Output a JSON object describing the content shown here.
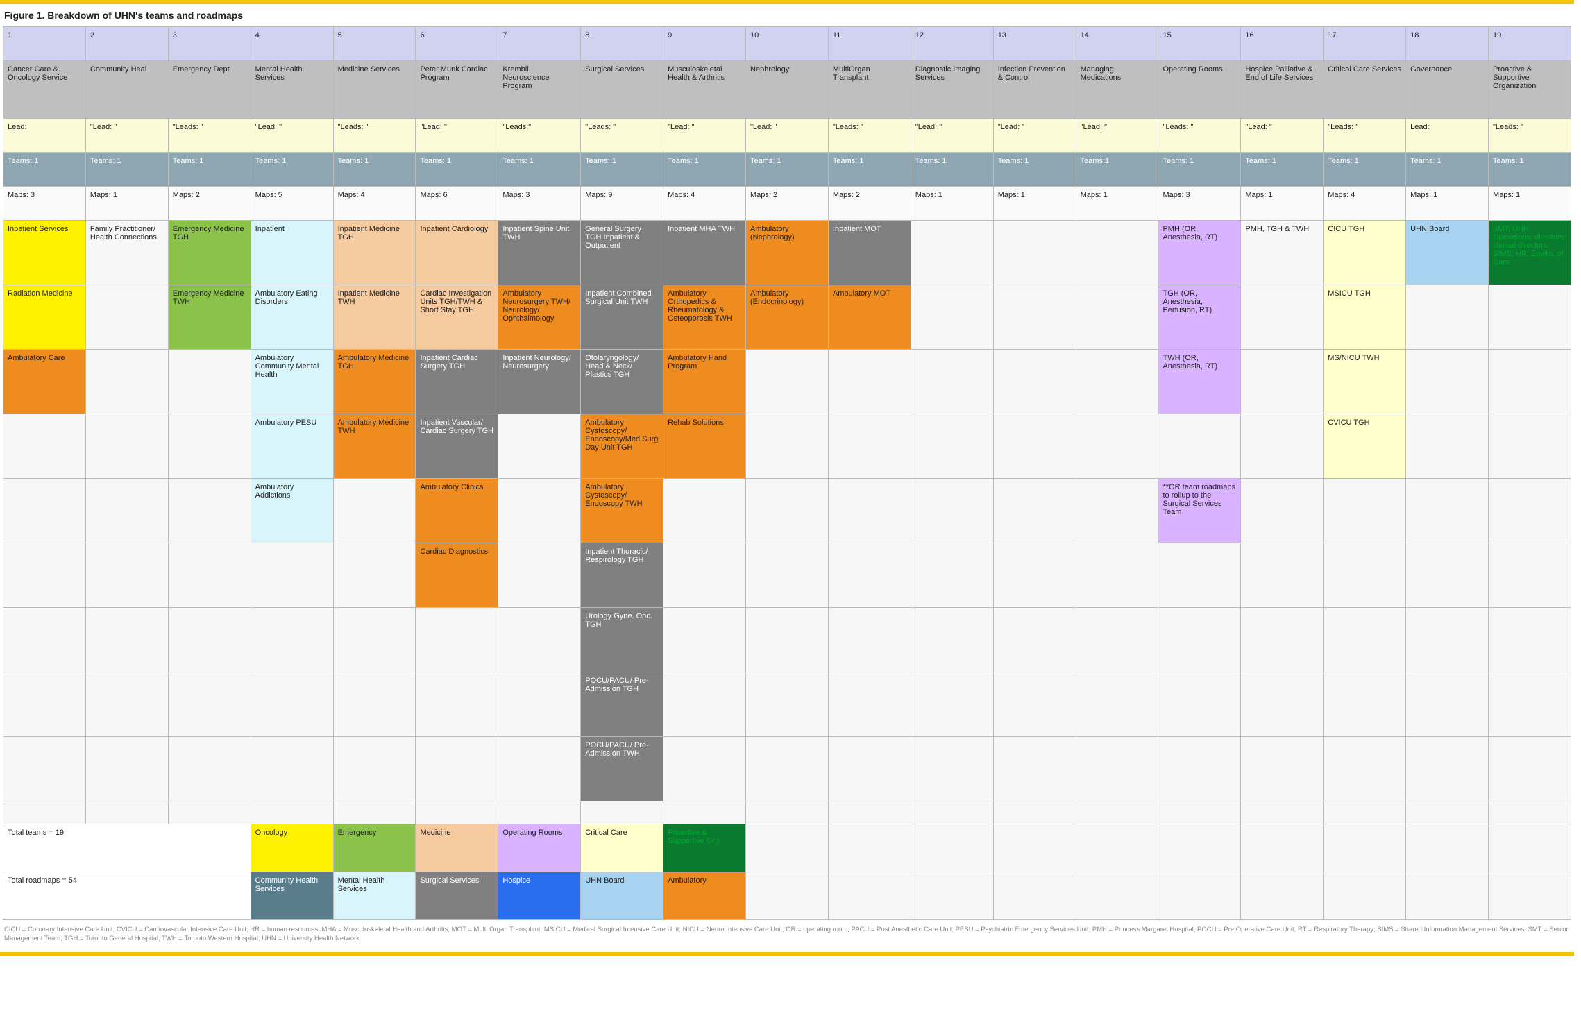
{
  "title": "Figure 1. Breakdown of UHN's teams and roadmaps",
  "columns": [
    {
      "num": "1",
      "name": "Cancer Care & Oncology Service",
      "lead": "Lead:",
      "teams": "Teams: 1",
      "maps": "Maps: 3"
    },
    {
      "num": "2",
      "name": "Community Heal",
      "lead": "\"Lead:\n\"",
      "teams": "Teams: 1",
      "maps": "Maps: 1"
    },
    {
      "num": "3",
      "name": "Emergency Dept",
      "lead": "\"Leads:\n\"",
      "teams": "Teams: 1",
      "maps": "Maps: 2"
    },
    {
      "num": "4",
      "name": "Mental Health Services",
      "lead": "\"Lead:\n\"",
      "teams": "Teams: 1",
      "maps": "Maps: 5"
    },
    {
      "num": "5",
      "name": "Medicine Services",
      "lead": "\"Leads:\n\"",
      "teams": "Teams: 1",
      "maps": "Maps: 4"
    },
    {
      "num": "6",
      "name": "Peter Munk Cardiac Program",
      "lead": "\"Lead:\n\"",
      "teams": "Teams: 1",
      "maps": "Maps: 6"
    },
    {
      "num": "7",
      "name": "Krembil Neuroscience Program",
      "lead": "\"Leads:\"",
      "teams": "Teams: 1",
      "maps": "Maps: 3"
    },
    {
      "num": "8",
      "name": "Surgical Services",
      "lead": "\"Leads:\n\"",
      "teams": "Teams: 1",
      "maps": "Maps: 9"
    },
    {
      "num": "9",
      "name": "Musculoskeletal Health & Arthritis",
      "lead": "\"Lead:\n\"",
      "teams": "Teams: 1",
      "maps": "Maps: 4"
    },
    {
      "num": "10",
      "name": "Nephrology",
      "lead": "\"Lead:\n\"",
      "teams": "Teams: 1",
      "maps": "Maps: 2"
    },
    {
      "num": "11",
      "name": "MultiOrgan Transplant",
      "lead": "\"Leads:\n\"",
      "teams": "Teams: 1",
      "maps": "Maps: 2"
    },
    {
      "num": "12",
      "name": "Diagnostic Imaging Services",
      "lead": "\"Lead:\n\"",
      "teams": "Teams: 1",
      "maps": "Maps: 1"
    },
    {
      "num": "13",
      "name": "Infection Prevention & Control",
      "lead": "\"Lead:\n\"",
      "teams": "Teams: 1",
      "maps": "Maps: 1"
    },
    {
      "num": "14",
      "name": "Managing Medications",
      "lead": "\"Lead:\n\"",
      "teams": "Teams:1",
      "maps": "Maps: 1"
    },
    {
      "num": "15",
      "name": "Operating Rooms",
      "lead": "\"Leads:\n\"",
      "teams": "Teams: 1",
      "maps": "Maps: 3"
    },
    {
      "num": "16",
      "name": "Hospice Palliative & End of Life Services",
      "lead": "\"Lead:\n\"",
      "teams": "Teams: 1",
      "maps": "Maps: 1"
    },
    {
      "num": "17",
      "name": "Critical Care Services",
      "lead": "\"Leads:\n\"",
      "teams": "Teams: 1",
      "maps": "Maps: 4"
    },
    {
      "num": "18",
      "name": "Governance",
      "lead": "Lead:",
      "teams": "Teams: 1",
      "maps": "Maps: 1"
    },
    {
      "num": "19",
      "name": "Proactive & Supportive Organization",
      "lead": "\"Leads:\n\"",
      "teams": "Teams: 1",
      "maps": "Maps: 1"
    }
  ],
  "mapRows": [
    [
      {
        "t": "Inpatient Services",
        "c": "c-yellow"
      },
      {
        "t": "Family Practitioner/ Health Connections",
        "c": "c-blank"
      },
      {
        "t": "Emergency Medicine TGH",
        "c": "c-green"
      },
      {
        "t": "Inpatient",
        "c": "c-palecyan"
      },
      {
        "t": "Inpatient Medicine TGH",
        "c": "c-peach"
      },
      {
        "t": "Inpatient Cardiology",
        "c": "c-peach"
      },
      {
        "t": "Inpatient Spine Unit TWH",
        "c": "c-gray"
      },
      {
        "t": "General Surgery TGH Inpatient & Outpatient",
        "c": "c-gray"
      },
      {
        "t": "Inpatient MHA TWH",
        "c": "c-gray"
      },
      {
        "t": "Ambulatory (Nephrology)",
        "c": "c-orange"
      },
      {
        "t": "Inpatient MOT",
        "c": "c-gray"
      },
      {
        "t": "",
        "c": "c-blank"
      },
      {
        "t": "",
        "c": "c-blank"
      },
      {
        "t": "",
        "c": "c-blank"
      },
      {
        "t": "PMH (OR, Anesthesia, RT)",
        "c": "c-lilac"
      },
      {
        "t": "PMH, TGH & TWH",
        "c": "c-blank"
      },
      {
        "t": "CICU TGH",
        "c": "c-paleyellow"
      },
      {
        "t": "UHN Board",
        "c": "c-skyblue"
      },
      {
        "t": "SMT; UHN Operations; directors; clinical directors; SIMS; HR; Enviro. of Care",
        "c": "c-darkgreen"
      }
    ],
    [
      {
        "t": "Radiation Medicine",
        "c": "c-yellow"
      },
      {
        "t": "",
        "c": "c-blank"
      },
      {
        "t": "Emergency Medicine TWH",
        "c": "c-green"
      },
      {
        "t": "Ambulatory Eating Disorders",
        "c": "c-palecyan"
      },
      {
        "t": "Inpatient Medicine TWH",
        "c": "c-peach"
      },
      {
        "t": "Cardiac Investigation Units TGH/TWH & Short Stay TGH",
        "c": "c-peach"
      },
      {
        "t": "Ambulatory Neurosurgery TWH/ Neurology/ Ophthalmology",
        "c": "c-orange"
      },
      {
        "t": "Inpatient Combined Surgical Unit TWH",
        "c": "c-gray"
      },
      {
        "t": "Ambulatory Orthopedics & Rheumatology & Osteoporosis TWH",
        "c": "c-orange"
      },
      {
        "t": "Ambulatory (Endocrinology)",
        "c": "c-orange"
      },
      {
        "t": "Ambulatory MOT",
        "c": "c-orange"
      },
      {
        "t": "",
        "c": "c-blank"
      },
      {
        "t": "",
        "c": "c-blank"
      },
      {
        "t": "",
        "c": "c-blank"
      },
      {
        "t": "TGH (OR, Anesthesia, Perfusion, RT)",
        "c": "c-lilac"
      },
      {
        "t": "",
        "c": "c-blank"
      },
      {
        "t": "MSICU TGH",
        "c": "c-paleyellow"
      },
      {
        "t": "",
        "c": "c-blank"
      },
      {
        "t": "",
        "c": "c-blank"
      }
    ],
    [
      {
        "t": "Ambulatory Care",
        "c": "c-orange"
      },
      {
        "t": "",
        "c": "c-blank"
      },
      {
        "t": "",
        "c": "c-blank"
      },
      {
        "t": "Ambulatory Community Mental Health",
        "c": "c-palecyan"
      },
      {
        "t": "Ambulatory Medicine TGH",
        "c": "c-orange"
      },
      {
        "t": "Inpatient Cardiac Surgery TGH",
        "c": "c-gray"
      },
      {
        "t": "Inpatient Neurology/ Neurosurgery",
        "c": "c-gray"
      },
      {
        "t": "Otolaryngology/ Head & Neck/ Plastics TGH",
        "c": "c-gray"
      },
      {
        "t": "Ambulatory Hand Program",
        "c": "c-orange"
      },
      {
        "t": "",
        "c": "c-blank"
      },
      {
        "t": "",
        "c": "c-blank"
      },
      {
        "t": "",
        "c": "c-blank"
      },
      {
        "t": "",
        "c": "c-blank"
      },
      {
        "t": "",
        "c": "c-blank"
      },
      {
        "t": "TWH (OR, Anesthesia, RT)",
        "c": "c-lilac"
      },
      {
        "t": "",
        "c": "c-blank"
      },
      {
        "t": "MS/NICU TWH",
        "c": "c-paleyellow"
      },
      {
        "t": "",
        "c": "c-blank"
      },
      {
        "t": "",
        "c": "c-blank"
      }
    ],
    [
      {
        "t": "",
        "c": "c-blank"
      },
      {
        "t": "",
        "c": "c-blank"
      },
      {
        "t": "",
        "c": "c-blank"
      },
      {
        "t": "Ambulatory PESU",
        "c": "c-palecyan"
      },
      {
        "t": "Ambulatory Medicine TWH",
        "c": "c-orange"
      },
      {
        "t": "Inpatient Vascular/ Cardiac Surgery TGH",
        "c": "c-gray"
      },
      {
        "t": "",
        "c": "c-blank"
      },
      {
        "t": "Ambulatory Cystoscopy/ Endoscopy/Med Surg Day Unit TGH",
        "c": "c-orange"
      },
      {
        "t": "Rehab Solutions",
        "c": "c-orange"
      },
      {
        "t": "",
        "c": "c-blank"
      },
      {
        "t": "",
        "c": "c-blank"
      },
      {
        "t": "",
        "c": "c-blank"
      },
      {
        "t": "",
        "c": "c-blank"
      },
      {
        "t": "",
        "c": "c-blank"
      },
      {
        "t": "",
        "c": "c-blank"
      },
      {
        "t": "",
        "c": "c-blank"
      },
      {
        "t": "CVICU TGH",
        "c": "c-paleyellow"
      },
      {
        "t": "",
        "c": "c-blank"
      },
      {
        "t": "",
        "c": "c-blank"
      }
    ],
    [
      {
        "t": "",
        "c": "c-blank"
      },
      {
        "t": "",
        "c": "c-blank"
      },
      {
        "t": "",
        "c": "c-blank"
      },
      {
        "t": "Ambulatory Addictions",
        "c": "c-palecyan"
      },
      {
        "t": "",
        "c": "c-blank"
      },
      {
        "t": "Ambulatory Clinics",
        "c": "c-orange"
      },
      {
        "t": "",
        "c": "c-blank"
      },
      {
        "t": "Ambulatory Cystoscopy/ Endoscopy TWH",
        "c": "c-orange"
      },
      {
        "t": "",
        "c": "c-blank"
      },
      {
        "t": "",
        "c": "c-blank"
      },
      {
        "t": "",
        "c": "c-blank"
      },
      {
        "t": "",
        "c": "c-blank"
      },
      {
        "t": "",
        "c": "c-blank"
      },
      {
        "t": "",
        "c": "c-blank"
      },
      {
        "t": "**OR team roadmaps to rollup to the Surgical Services Team",
        "c": "c-lilac"
      },
      {
        "t": "",
        "c": "c-blank"
      },
      {
        "t": "",
        "c": "c-blank"
      },
      {
        "t": "",
        "c": "c-blank"
      },
      {
        "t": "",
        "c": "c-blank"
      }
    ],
    [
      {
        "t": "",
        "c": "c-blank"
      },
      {
        "t": "",
        "c": "c-blank"
      },
      {
        "t": "",
        "c": "c-blank"
      },
      {
        "t": "",
        "c": "c-blank"
      },
      {
        "t": "",
        "c": "c-blank"
      },
      {
        "t": "Cardiac Diagnostics",
        "c": "c-orange"
      },
      {
        "t": "",
        "c": "c-blank"
      },
      {
        "t": "Inpatient Thoracic/ Respirology TGH",
        "c": "c-gray"
      },
      {
        "t": "",
        "c": "c-blank"
      },
      {
        "t": "",
        "c": "c-blank"
      },
      {
        "t": "",
        "c": "c-blank"
      },
      {
        "t": "",
        "c": "c-blank"
      },
      {
        "t": "",
        "c": "c-blank"
      },
      {
        "t": "",
        "c": "c-blank"
      },
      {
        "t": "",
        "c": "c-blank"
      },
      {
        "t": "",
        "c": "c-blank"
      },
      {
        "t": "",
        "c": "c-blank"
      },
      {
        "t": "",
        "c": "c-blank"
      },
      {
        "t": "",
        "c": "c-blank"
      }
    ],
    [
      {
        "t": "",
        "c": "c-blank"
      },
      {
        "t": "",
        "c": "c-blank"
      },
      {
        "t": "",
        "c": "c-blank"
      },
      {
        "t": "",
        "c": "c-blank"
      },
      {
        "t": "",
        "c": "c-blank"
      },
      {
        "t": "",
        "c": "c-blank"
      },
      {
        "t": "",
        "c": "c-blank"
      },
      {
        "t": "Urology Gyne. Onc. TGH",
        "c": "c-gray"
      },
      {
        "t": "",
        "c": "c-blank"
      },
      {
        "t": "",
        "c": "c-blank"
      },
      {
        "t": "",
        "c": "c-blank"
      },
      {
        "t": "",
        "c": "c-blank"
      },
      {
        "t": "",
        "c": "c-blank"
      },
      {
        "t": "",
        "c": "c-blank"
      },
      {
        "t": "",
        "c": "c-blank"
      },
      {
        "t": "",
        "c": "c-blank"
      },
      {
        "t": "",
        "c": "c-blank"
      },
      {
        "t": "",
        "c": "c-blank"
      },
      {
        "t": "",
        "c": "c-blank"
      }
    ],
    [
      {
        "t": "",
        "c": "c-blank"
      },
      {
        "t": "",
        "c": "c-blank"
      },
      {
        "t": "",
        "c": "c-blank"
      },
      {
        "t": "",
        "c": "c-blank"
      },
      {
        "t": "",
        "c": "c-blank"
      },
      {
        "t": "",
        "c": "c-blank"
      },
      {
        "t": "",
        "c": "c-blank"
      },
      {
        "t": "POCU/PACU/ Pre-Admission TGH",
        "c": "c-gray"
      },
      {
        "t": "",
        "c": "c-blank"
      },
      {
        "t": "",
        "c": "c-blank"
      },
      {
        "t": "",
        "c": "c-blank"
      },
      {
        "t": "",
        "c": "c-blank"
      },
      {
        "t": "",
        "c": "c-blank"
      },
      {
        "t": "",
        "c": "c-blank"
      },
      {
        "t": "",
        "c": "c-blank"
      },
      {
        "t": "",
        "c": "c-blank"
      },
      {
        "t": "",
        "c": "c-blank"
      },
      {
        "t": "",
        "c": "c-blank"
      },
      {
        "t": "",
        "c": "c-blank"
      }
    ],
    [
      {
        "t": "",
        "c": "c-blank"
      },
      {
        "t": "",
        "c": "c-blank"
      },
      {
        "t": "",
        "c": "c-blank"
      },
      {
        "t": "",
        "c": "c-blank"
      },
      {
        "t": "",
        "c": "c-blank"
      },
      {
        "t": "",
        "c": "c-blank"
      },
      {
        "t": "",
        "c": "c-blank"
      },
      {
        "t": "POCU/PACU/ Pre-Admission TWH",
        "c": "c-gray"
      },
      {
        "t": "",
        "c": "c-blank"
      },
      {
        "t": "",
        "c": "c-blank"
      },
      {
        "t": "",
        "c": "c-blank"
      },
      {
        "t": "",
        "c": "c-blank"
      },
      {
        "t": "",
        "c": "c-blank"
      },
      {
        "t": "",
        "c": "c-blank"
      },
      {
        "t": "",
        "c": "c-blank"
      },
      {
        "t": "",
        "c": "c-blank"
      },
      {
        "t": "",
        "c": "c-blank"
      },
      {
        "t": "",
        "c": "c-blank"
      },
      {
        "t": "",
        "c": "c-blank"
      }
    ]
  ],
  "legend": {
    "rowA": {
      "label": "Total teams = 19",
      "cells": [
        {
          "t": "Oncology",
          "c": "c-yellow"
        },
        {
          "t": "Emergency",
          "c": "c-green"
        },
        {
          "t": "Medicine",
          "c": "c-peach"
        },
        {
          "t": "Operating Rooms",
          "c": "c-lilac"
        },
        {
          "t": "Critical Care",
          "c": "c-paleyellow"
        },
        {
          "t": "Proactive & Supportive Org",
          "c": "c-darkgreen"
        }
      ]
    },
    "rowB": {
      "label": "Total roadmaps = 54",
      "cells": [
        {
          "t": "Community Health Services",
          "c": "c-steel"
        },
        {
          "t": "Mental Health Services",
          "c": "c-palecyan"
        },
        {
          "t": "Surgical Services",
          "c": "c-gray"
        },
        {
          "t": "Hospice",
          "c": "c-blue"
        },
        {
          "t": "UHN Board",
          "c": "c-skyblue"
        },
        {
          "t": "Ambulatory",
          "c": "c-orange"
        }
      ]
    }
  },
  "abbr": "CICU = Coronary Intensive Care Unit; CVICU = Cardiovascular Intensive Care Unit; HR = human resources; MHA = Musculoskeletal Health and Arthritis; MOT = Multi Organ Transplant; MSICU = Medical Surgical Intensive Care Unit; NICU = Neuro Intensive Care Unit; OR = operating room; PACU = Post Anesthetic Care Unit; PESU = Psychiatric Emergency Services Unit; PMH = Princess Margaret Hospital; POCU = Pre Operative Care Unit; RT = Respiratory Therapy; SIMS = Shared Information Management Services; SMT = Senior Management Team; TGH = Toronto General Hospital; TWH = Toronto Western Hospital; UHN = University Health Network."
}
